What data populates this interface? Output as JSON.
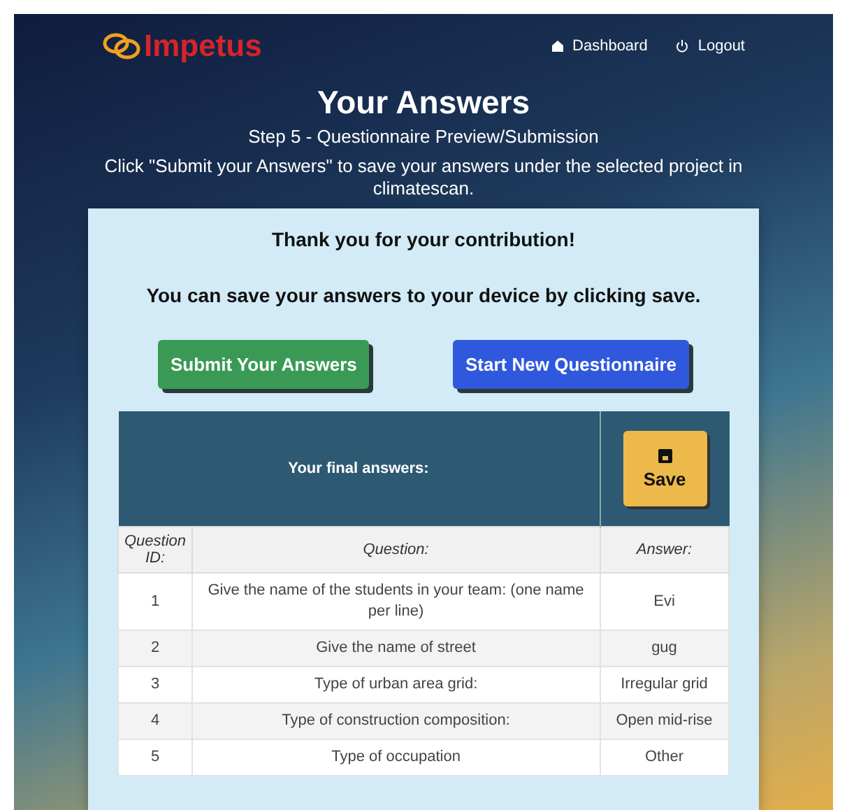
{
  "nav": {
    "logo": "Impetus",
    "links": [
      {
        "kind": "home",
        "label": "Dashboard"
      },
      {
        "kind": "power",
        "label": "Logout"
      }
    ]
  },
  "header": {
    "title": "Your Answers",
    "step": "Step 5 - Questionnaire Preview/Submission",
    "instructions": "Click \"Submit your Answers\" to save your answers under the selected project in climatescan."
  },
  "card": {
    "thanks": "Thank you for your contribution!",
    "save_hint": "You can save your answers to your device by clicking save.",
    "buttons": [
      {
        "kind": "submit",
        "label": "Submit Your Answers"
      },
      {
        "kind": "new",
        "label": "Start New Questionnaire"
      }
    ],
    "table": {
      "caption": "Your final answers:",
      "save_button": "Save",
      "columns": [
        "Question ID:",
        "Question:",
        "Answer:"
      ],
      "rows": [
        {
          "id": "1",
          "question": "Give the name of the students in your team: (one name per line)",
          "answer": "Evi"
        },
        {
          "id": "2",
          "question": "Give the name of street",
          "answer": "gug"
        },
        {
          "id": "3",
          "question": "Type of urban area grid:",
          "answer": "Irregular grid"
        },
        {
          "id": "4",
          "question": "Type of construction composition:",
          "answer": "Open mid-rise"
        },
        {
          "id": "5",
          "question": "Type of occupation",
          "answer": "Other"
        }
      ]
    }
  }
}
